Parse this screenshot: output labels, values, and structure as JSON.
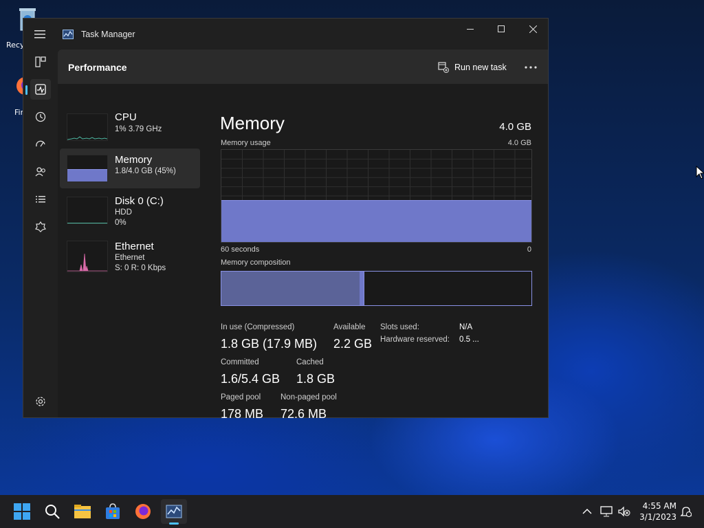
{
  "desktop": {
    "recycle_label": "Recy",
    "firefox_label": "Fir"
  },
  "window": {
    "title": "Task Manager"
  },
  "header": {
    "page_title": "Performance",
    "run_new_task": "Run new task"
  },
  "nav": {
    "items": [
      "hamburger-icon",
      "processes-icon",
      "performance-icon",
      "app-history-icon",
      "startup-apps-icon",
      "users-icon",
      "details-icon",
      "services-icon",
      "settings-icon"
    ],
    "active": "performance"
  },
  "devices": [
    {
      "name": "CPU",
      "line1": "1% 3.79 GHz",
      "line2": ""
    },
    {
      "name": "Memory",
      "line1": "1.8/4.0 GB (45%)",
      "line2": ""
    },
    {
      "name": "Disk 0 (C:)",
      "line1": "HDD",
      "line2": "0%"
    },
    {
      "name": "Ethernet",
      "line1": "Ethernet",
      "line2": "S: 0 R: 0 Kbps"
    }
  ],
  "memory": {
    "heading": "Memory",
    "total": "4.0 GB",
    "usage_label": "Memory usage",
    "usage_max": "4.0 GB",
    "time_left": "60 seconds",
    "time_right": "0",
    "composition_label": "Memory composition",
    "usage_fraction": 0.45,
    "stats": {
      "in_use_label": "In use (Compressed)",
      "in_use_value": "1.8 GB (17.9 MB)",
      "available_label": "Available",
      "available_value": "2.2 GB",
      "committed_label": "Committed",
      "committed_value": "1.6/5.4 GB",
      "cached_label": "Cached",
      "cached_value": "1.8 GB",
      "paged_label": "Paged pool",
      "paged_value": "178 MB",
      "nonpaged_label": "Non-paged pool",
      "nonpaged_value": "72.6 MB",
      "slots_label": "Slots used:",
      "slots_value": "N/A",
      "hw_reserved_label": "Hardware reserved:",
      "hw_reserved_value": "0.5 ..."
    }
  },
  "taskbar": {
    "time": "4:55 AM",
    "date": "3/1/2023"
  },
  "colors": {
    "memory_accent": "#6f78c9",
    "memory_border": "#8a92e6",
    "nav_accent": "#4cc2ff",
    "ethernet_accent": "#d86aa8"
  }
}
